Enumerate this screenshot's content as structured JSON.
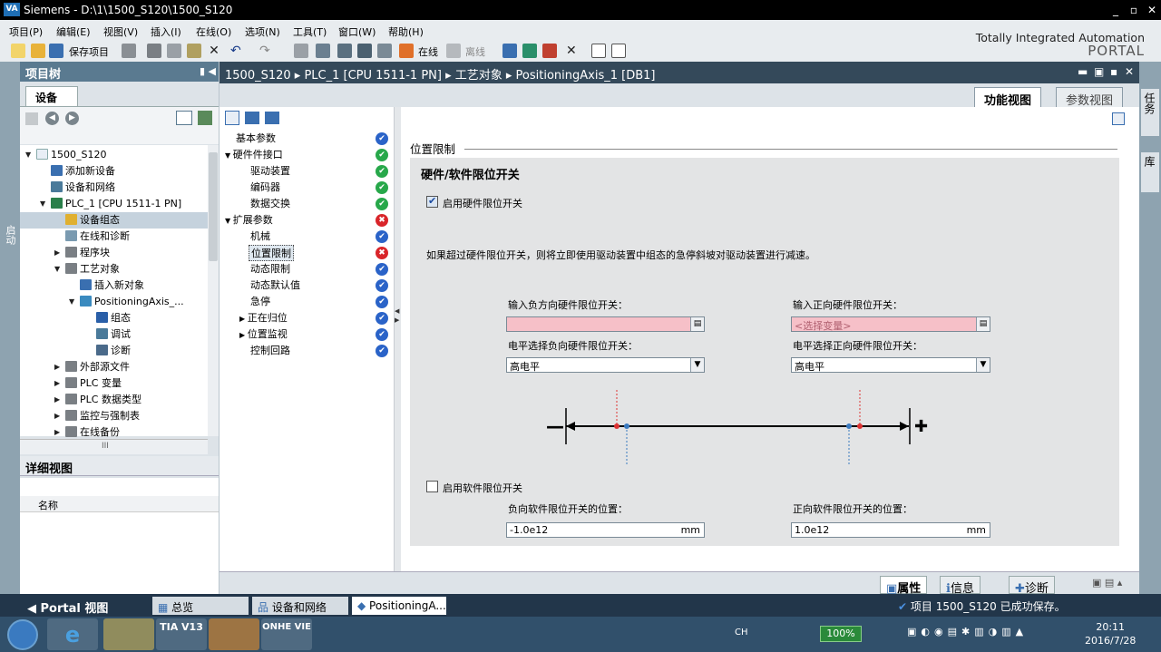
{
  "titlebar": {
    "logo": "VA",
    "title": "Siemens  -  D:\\1\\1500_S120\\1500_S120",
    "min": "_",
    "restore": "▫",
    "close": "✕"
  },
  "menu": [
    "项目(P)",
    "编辑(E)",
    "视图(V)",
    "插入(I)",
    "在线(O)",
    "选项(N)",
    "工具(T)",
    "窗口(W)",
    "帮助(H)"
  ],
  "toolbar": {
    "save": "保存项目",
    "online": "在线",
    "offline": "离线"
  },
  "brand": {
    "line1": "Totally Integrated Automation",
    "line2": "PORTAL"
  },
  "leftstrip": {
    "label": "启动"
  },
  "project_tree": {
    "header": "项目树",
    "tab": "设备",
    "items": [
      "1500_S120",
      "添加新设备",
      "设备和网络",
      "PLC_1 [CPU 1511-1 PN]",
      "设备组态",
      "在线和诊断",
      "程序块",
      "工艺对象",
      "插入新对象",
      "PositioningAxis_...",
      "组态",
      "调试",
      "诊断",
      "外部源文件",
      "PLC 变量",
      "PLC 数据类型",
      "监控与强制表",
      "在线备份"
    ],
    "hscroll": "III"
  },
  "detail_view": {
    "header": "详细视图",
    "col_name": "名称"
  },
  "editor": {
    "breadcrumb": "1500_S120  ▸  PLC_1 [CPU 1511-1 PN]  ▸  工艺对象  ▸  PositioningAxis_1 [DB1]",
    "tabs": [
      "功能视图",
      "参数视图"
    ],
    "nav": [
      {
        "label": "基本参数",
        "status": "blue"
      },
      {
        "label": "硬件件接口",
        "status": "ok"
      },
      {
        "label": "驱动装置",
        "status": "ok"
      },
      {
        "label": "编码器",
        "status": "ok"
      },
      {
        "label": "数据交换",
        "status": "ok"
      },
      {
        "label": "扩展参数",
        "status": "err"
      },
      {
        "label": "机械",
        "status": "blue"
      },
      {
        "label": "位置限制",
        "status": "err"
      },
      {
        "label": "动态限制",
        "status": "blue"
      },
      {
        "label": "动态默认值",
        "status": "blue"
      },
      {
        "label": "急停",
        "status": "blue"
      },
      {
        "label": "正在归位",
        "status": "blue"
      },
      {
        "label": "位置监视",
        "status": "blue"
      },
      {
        "label": "控制回路",
        "status": "blue"
      }
    ],
    "section_title": "位置限制",
    "group_title": "硬件/软件限位开关",
    "hw_enable_label": "启用硬件限位开关",
    "hw_enabled": true,
    "info_text": "如果超过硬件限位开关，则将立即使用驱动装置中组态的急停斜坡对驱动装置进行减速。",
    "neg_hw_label": "输入负方向硬件限位开关：",
    "neg_hw_value": "",
    "pos_hw_label": "输入正向硬件限位开关：",
    "pos_hw_placeholder": "<选择变量>",
    "neg_level_label": "电平选择负向硬件限位开关：",
    "neg_level_value": "高电平",
    "pos_level_label": "电平选择正向硬件限位开关：",
    "pos_level_value": "高电平",
    "minus": "—",
    "plus": "✚",
    "sw_enable_label": "启用软件限位开关",
    "sw_enabled": false,
    "neg_sw_label": "负向软件限位开关的位置：",
    "neg_sw_value": "-1.0e12",
    "pos_sw_label": "正向软件限位开关的位置：",
    "pos_sw_value": "1.0e12",
    "unit": "mm"
  },
  "status_tabs": [
    "属性",
    "信息",
    "诊断"
  ],
  "rightstrip": [
    "任务",
    "库"
  ],
  "portalbar": {
    "portal": "◀  Portal  视图",
    "tabs": [
      "总览",
      "设备和网络",
      "PositioningA..."
    ],
    "saved": "项目 1500_S120 已成功保存。"
  },
  "taskbar": {
    "time": "20:11",
    "date": "2016/7/28",
    "battery": "100%",
    "lang": "CH",
    "tia": "TIA V13",
    "onhe": "ONHE VIE"
  },
  "colors": {
    "ok": "#27a84a",
    "info": "#2a63c8",
    "error": "#d9252a",
    "required": "#f6c0c8",
    "header": "#34495a"
  }
}
